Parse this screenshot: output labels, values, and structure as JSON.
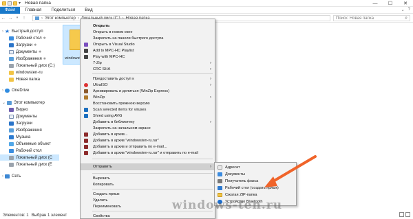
{
  "window": {
    "title": "Новая папка",
    "controls": [
      "—",
      "☐",
      "✕"
    ]
  },
  "ribbon": {
    "tabs": [
      "Файл",
      "Главная",
      "Поделиться",
      "Вид"
    ],
    "help": "?"
  },
  "address": {
    "crumbs": [
      "Этот компьютер",
      "Локальный диск (C:)",
      "Новая папка"
    ],
    "search_placeholder": "Поиск: Новая папка",
    "back": "←",
    "forward": "→",
    "up": "↑"
  },
  "nav": {
    "items": [
      {
        "label": "Быстрый доступ",
        "icon": "star-icon"
      },
      {
        "label": "Рабочий стол",
        "icon": "desktop-icon",
        "pinned": true
      },
      {
        "label": "Загрузки",
        "icon": "download-icon",
        "pinned": true
      },
      {
        "label": "Документы",
        "icon": "documents-icon",
        "pinned": true
      },
      {
        "label": "Изображения",
        "icon": "pictures-icon",
        "pinned": true
      },
      {
        "label": "Локальный диск (C:)",
        "icon": "disk-icon"
      },
      {
        "label": "windowsten-ru",
        "icon": "folder-icon"
      },
      {
        "label": "Новая папка",
        "icon": "folder-icon"
      },
      {
        "label": "OneDrive",
        "icon": "cloud-icon"
      },
      {
        "label": "Этот компьютер",
        "icon": "computer-icon"
      },
      {
        "label": "Видео",
        "icon": "video-icon"
      },
      {
        "label": "Документы",
        "icon": "documents-icon"
      },
      {
        "label": "Загрузки",
        "icon": "download-icon"
      },
      {
        "label": "Изображения",
        "icon": "pictures-icon"
      },
      {
        "label": "Музыка",
        "icon": "music-icon"
      },
      {
        "label": "Объемные объект",
        "icon": "3d-objects-icon"
      },
      {
        "label": "Рабочий стол",
        "icon": "desktop-icon"
      },
      {
        "label": "Локальный диск (C",
        "icon": "disk-icon"
      },
      {
        "label": "Локальный диск (E",
        "icon": "disk-icon"
      },
      {
        "label": "Сеть",
        "icon": "network-icon"
      }
    ],
    "pin_glyph": "✱"
  },
  "content": {
    "file_name": "windowsten-ru"
  },
  "context_menu": {
    "items": [
      {
        "label": "Открыть",
        "bold": true
      },
      {
        "label": "Открыть в новом окне"
      },
      {
        "label": "Закрепить на панели быстрого доступа"
      },
      {
        "label": "Открыть в Visual Studio",
        "icon": "visual-studio-icon"
      },
      {
        "label": "Add to MPC-HC Playlist",
        "icon": "mpc-hc-icon"
      },
      {
        "label": "Play with MPC-HC",
        "icon": "mpc-hc-icon"
      },
      {
        "label": "7-Zip",
        "submenu": true
      },
      {
        "label": "CRC SHA",
        "submenu": true
      },
      {
        "sep": true
      },
      {
        "label": "Предоставить доступ к",
        "submenu": true
      },
      {
        "label": "UltraISO",
        "icon": "ultraiso-icon",
        "submenu": true
      },
      {
        "label": "Архивировать и делиться (WinZip Express)",
        "icon": "winzip-icon"
      },
      {
        "label": "WinZip",
        "icon": "winzip-icon",
        "submenu": true
      },
      {
        "label": "Восстановить прежнюю версию"
      },
      {
        "label": "Scan selected items for viruses",
        "icon": "avg-icon"
      },
      {
        "label": "Shred using AVG",
        "icon": "avg-icon"
      },
      {
        "label": "Добавить в библиотеку",
        "submenu": true
      },
      {
        "label": "Закрепить на начальном экране"
      },
      {
        "label": "Добавить в архив...",
        "icon": "archive-icon"
      },
      {
        "label": "Добавить в архив \"windowsten-ru.rar\"",
        "icon": "archive-icon"
      },
      {
        "label": "Добавить в архив и отправить по e-mail...",
        "icon": "archive-icon"
      },
      {
        "label": "Добавить в архив \"windowsten-ru.rar\" и отправить по e-mail",
        "icon": "archive-icon"
      },
      {
        "sep": true
      },
      {
        "label": "Отправить",
        "submenu": true,
        "highlighted": true
      },
      {
        "sep": true
      },
      {
        "label": "Вырезать"
      },
      {
        "label": "Копировать"
      },
      {
        "sep": true
      },
      {
        "label": "Создать ярлык"
      },
      {
        "label": "Удалить"
      },
      {
        "label": "Переименовать"
      },
      {
        "sep": true
      },
      {
        "label": "Свойства"
      }
    ],
    "arrow_glyph": "›"
  },
  "send_to_menu": {
    "items": [
      {
        "label": "Адресат",
        "icon": "contact-icon"
      },
      {
        "label": "Документы",
        "icon": "documents-icon"
      },
      {
        "label": "Получатель факса",
        "icon": "fax-icon"
      },
      {
        "label": "Рабочий стол (создать ярлык)",
        "icon": "desktop-icon"
      },
      {
        "label": "Сжатая ZIP-папка",
        "icon": "zip-folder-icon"
      },
      {
        "label": "Устройство Bluetooth",
        "icon": "bluetooth-icon"
      }
    ]
  },
  "annotation": {
    "color": "#f0642a",
    "target": "Рабочий стол (создать ярлык)"
  },
  "status": {
    "items_count": "Элементов: 1",
    "selected": "Выбран 1 элемент"
  },
  "watermark": "windows-ten.ru",
  "colors": {
    "selection": "#cce8ff",
    "menu_bg": "#f2f2f2",
    "menu_highlight": "#d0d0d0",
    "file_tab": "#1979ca"
  }
}
